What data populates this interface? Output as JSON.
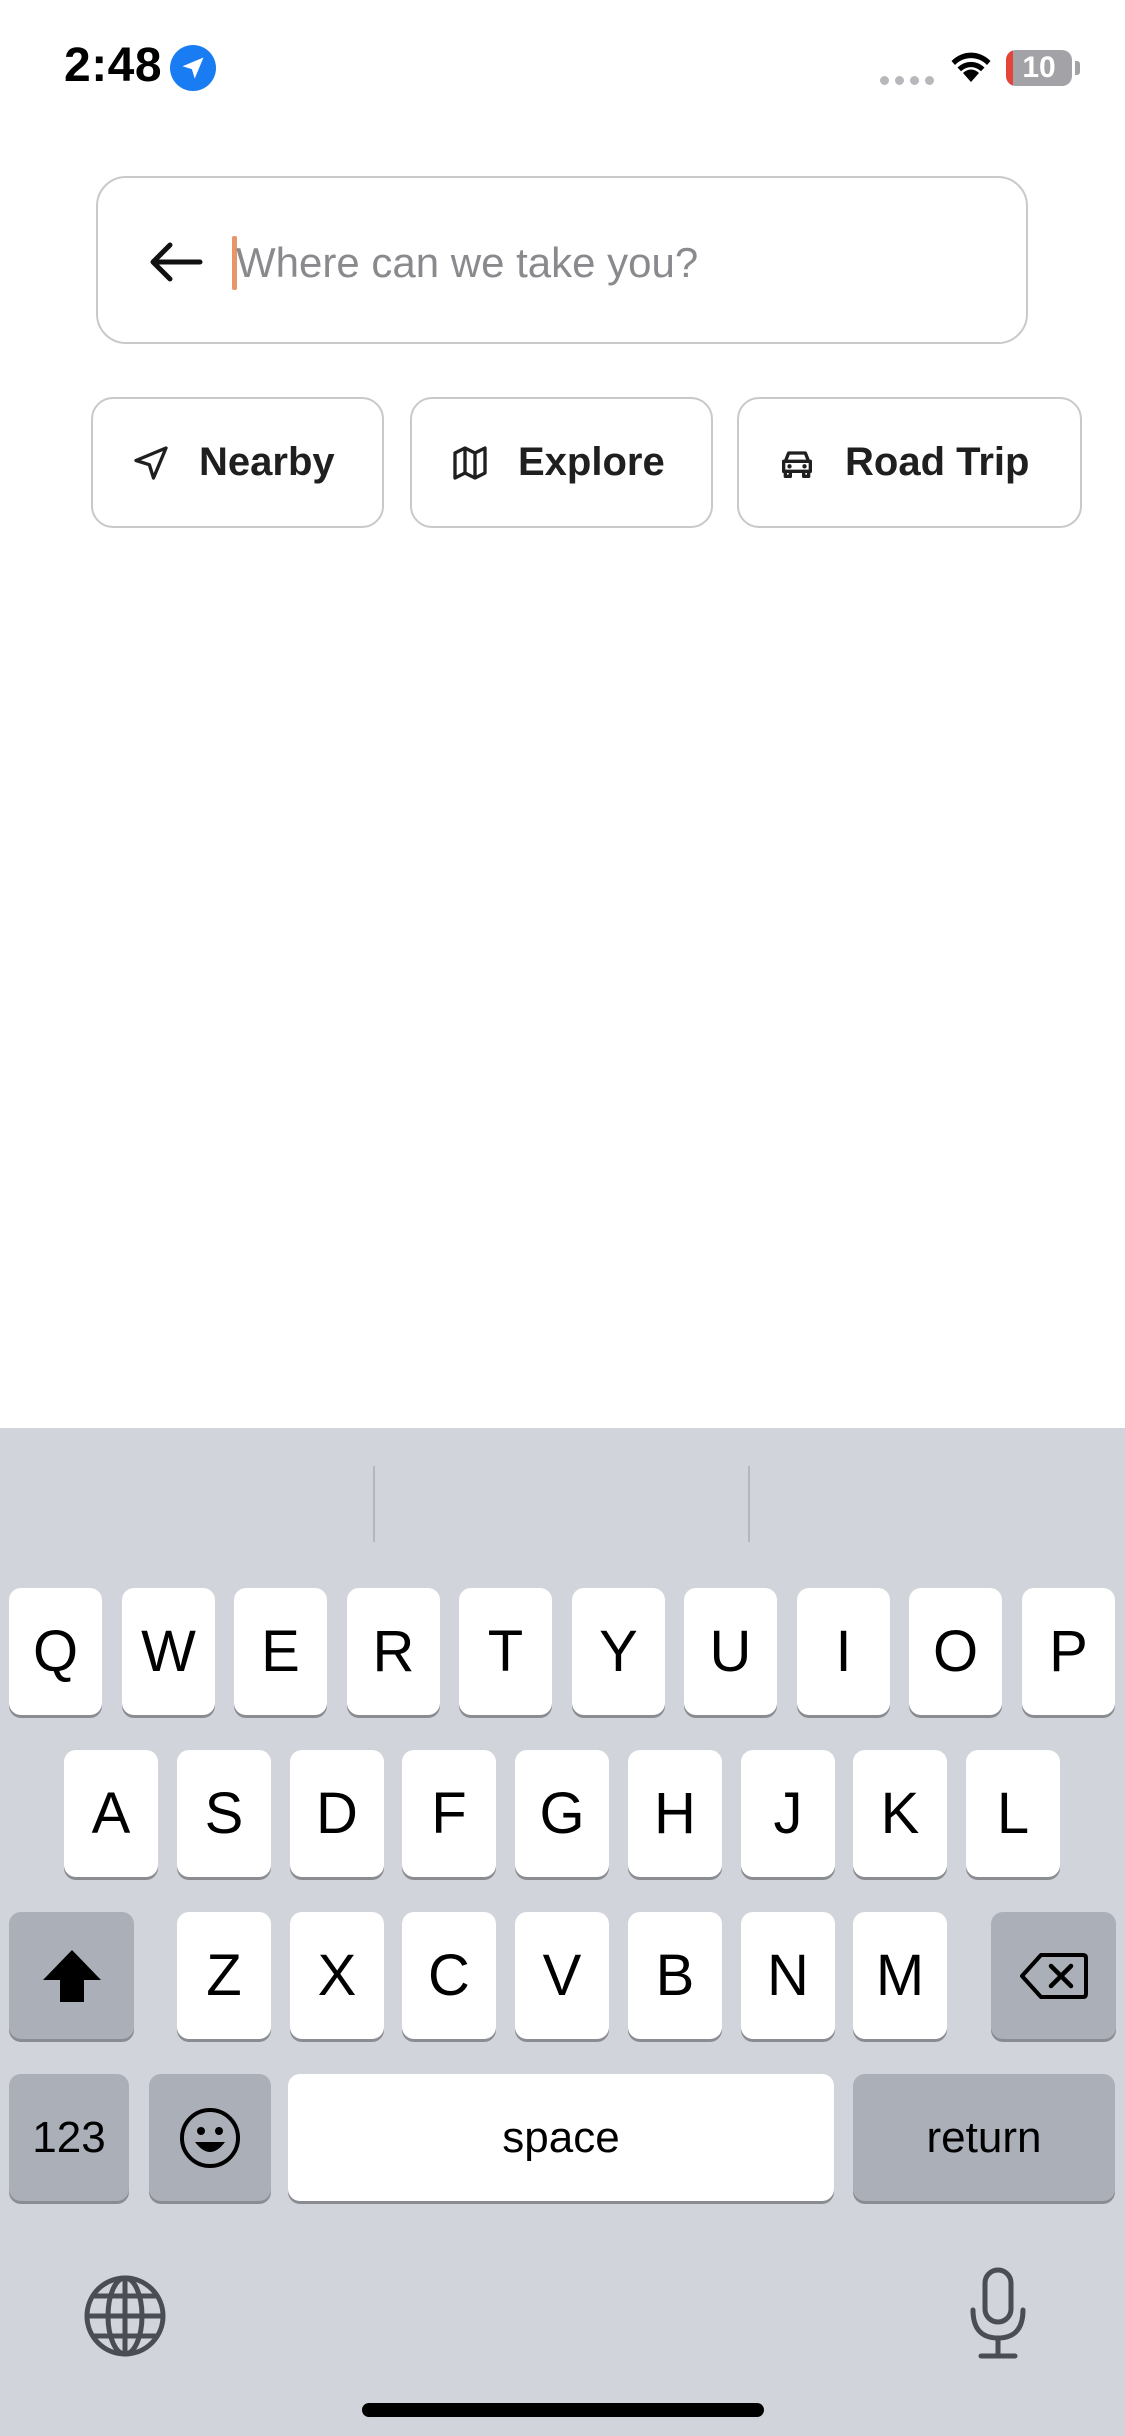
{
  "status_bar": {
    "time": "2:48",
    "battery_level": "10",
    "battery_fraction": 0.1,
    "icons": [
      "location-arrow-icon",
      "signal-dots-icon",
      "wifi-icon",
      "battery-icon"
    ],
    "colors": {
      "location_badge": "#1a7cf2",
      "battery_low": "#e5443a"
    }
  },
  "search": {
    "placeholder": "Where can we take you?",
    "value": "",
    "back_icon": "arrow-left-icon",
    "cursor_color": "#e8956a"
  },
  "chips": [
    {
      "label": "Nearby",
      "icon": "navigation-arrow-icon"
    },
    {
      "label": "Explore",
      "icon": "map-icon"
    },
    {
      "label": "Road Trip",
      "icon": "car-icon"
    }
  ],
  "keyboard": {
    "row1": [
      "Q",
      "W",
      "E",
      "R",
      "T",
      "Y",
      "U",
      "I",
      "O",
      "P"
    ],
    "row2": [
      "A",
      "S",
      "D",
      "F",
      "G",
      "H",
      "J",
      "K",
      "L"
    ],
    "row3": [
      "Z",
      "X",
      "C",
      "V",
      "B",
      "N",
      "M"
    ],
    "numbers_label": "123",
    "space_label": "space",
    "return_label": "return",
    "icons": [
      "shift-icon",
      "backspace-icon",
      "emoji-icon",
      "globe-icon",
      "microphone-icon"
    ]
  }
}
